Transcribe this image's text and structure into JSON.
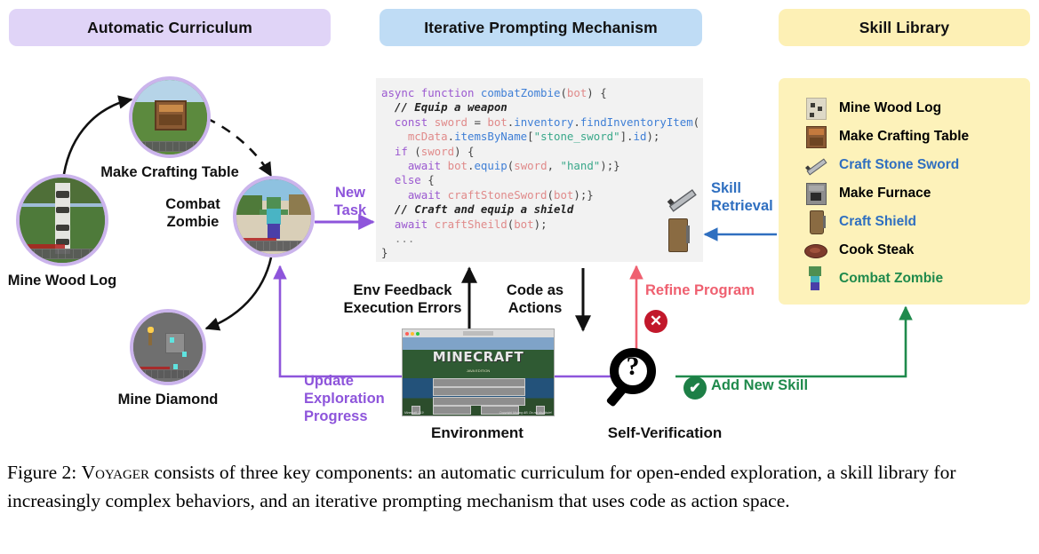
{
  "headers": {
    "curriculum": "Automatic Curriculum",
    "iterative": "Iterative Prompting Mechanism",
    "skill_library": "Skill Library"
  },
  "colors": {
    "curriculum_header_bg": "#e0d4f7",
    "iterative_header_bg": "#bfdcf5",
    "skill_header_bg": "#fdf0b5",
    "skill_panel_bg": "#fdf2ba",
    "code_panel_bg": "#f2f2f2",
    "purple_arrow": "#8e55db",
    "blue_arrow": "#2f6fc0",
    "red_arrow": "#ef6070",
    "green_arrow": "#1f8a4c",
    "black_arrow": "#111111",
    "circle_ring": "#cbb4ec"
  },
  "curriculum": {
    "nodes": [
      {
        "id": "mine-wood-log",
        "label": "Mine Wood Log"
      },
      {
        "id": "make-crafting-table",
        "label": "Make Crafting Table"
      },
      {
        "id": "combat-zombie",
        "label": "Combat\nZombie"
      },
      {
        "id": "mine-diamond",
        "label": "Mine Diamond"
      }
    ]
  },
  "code": {
    "lines": [
      {
        "tokens": [
          {
            "t": "async ",
            "c": "k"
          },
          {
            "t": "function ",
            "c": "k"
          },
          {
            "t": "combatZombie",
            "c": "fn"
          },
          {
            "t": "(",
            "c": "pl"
          },
          {
            "t": "bot",
            "c": "var"
          },
          {
            "t": ") {",
            "c": "pl"
          }
        ]
      },
      {
        "tokens": [
          {
            "t": "  // Equip a weapon",
            "c": "cm"
          }
        ]
      },
      {
        "tokens": [
          {
            "t": "  ",
            "c": "pl"
          },
          {
            "t": "const ",
            "c": "k"
          },
          {
            "t": "sword ",
            "c": "var"
          },
          {
            "t": "= ",
            "c": "pl"
          },
          {
            "t": "bot",
            "c": "var"
          },
          {
            "t": ".",
            "c": "pl"
          },
          {
            "t": "inventory",
            "c": "fn"
          },
          {
            "t": ".",
            "c": "pl"
          },
          {
            "t": "findInventoryItem",
            "c": "fn"
          },
          {
            "t": "(",
            "c": "pl"
          }
        ]
      },
      {
        "tokens": [
          {
            "t": "    ",
            "c": "pl"
          },
          {
            "t": "mcData",
            "c": "var"
          },
          {
            "t": ".",
            "c": "pl"
          },
          {
            "t": "itemsByName",
            "c": "fn"
          },
          {
            "t": "[",
            "c": "pl"
          },
          {
            "t": "\"stone_sword\"",
            "c": "str"
          },
          {
            "t": "].",
            "c": "pl"
          },
          {
            "t": "id",
            "c": "fn"
          },
          {
            "t": ");",
            "c": "pl"
          }
        ]
      },
      {
        "tokens": [
          {
            "t": "  ",
            "c": "pl"
          },
          {
            "t": "if",
            "c": "k"
          },
          {
            "t": " (",
            "c": "pl"
          },
          {
            "t": "sword",
            "c": "var"
          },
          {
            "t": ") {",
            "c": "pl"
          }
        ]
      },
      {
        "tokens": [
          {
            "t": "    ",
            "c": "pl"
          },
          {
            "t": "await ",
            "c": "k"
          },
          {
            "t": "bot",
            "c": "var"
          },
          {
            "t": ".",
            "c": "pl"
          },
          {
            "t": "equip",
            "c": "fn"
          },
          {
            "t": "(",
            "c": "pl"
          },
          {
            "t": "sword",
            "c": "var"
          },
          {
            "t": ", ",
            "c": "pl"
          },
          {
            "t": "\"hand\"",
            "c": "str"
          },
          {
            "t": ");}",
            "c": "pl"
          }
        ]
      },
      {
        "tokens": [
          {
            "t": "  ",
            "c": "pl"
          },
          {
            "t": "else",
            "c": "k"
          },
          {
            "t": " {",
            "c": "pl"
          }
        ]
      },
      {
        "tokens": [
          {
            "t": "    ",
            "c": "pl"
          },
          {
            "t": "await ",
            "c": "k"
          },
          {
            "t": "craftStoneSword",
            "c": "var"
          },
          {
            "t": "(",
            "c": "pl"
          },
          {
            "t": "bot",
            "c": "var"
          },
          {
            "t": ");}",
            "c": "pl"
          }
        ]
      },
      {
        "tokens": [
          {
            "t": "  // Craft and equip a shield",
            "c": "cm"
          }
        ]
      },
      {
        "tokens": [
          {
            "t": "  ",
            "c": "pl"
          },
          {
            "t": "await ",
            "c": "k"
          },
          {
            "t": "craftSheild",
            "c": "var"
          },
          {
            "t": "(",
            "c": "pl"
          },
          {
            "t": "bot",
            "c": "var"
          },
          {
            "t": ");",
            "c": "pl"
          }
        ]
      },
      {
        "tokens": [
          {
            "t": "  ...",
            "c": "dim"
          }
        ]
      },
      {
        "tokens": [
          {
            "t": "}",
            "c": "pl"
          }
        ]
      }
    ]
  },
  "skill_library": {
    "items": [
      {
        "icon": "wood-log-icon",
        "label": "Mine Wood  Log",
        "color": "#111111"
      },
      {
        "icon": "crafting-table-icon",
        "label": "Make Crafting Table",
        "color": "#111111"
      },
      {
        "icon": "stone-sword-icon",
        "label": "Craft Stone Sword",
        "color": "#2f6fc0"
      },
      {
        "icon": "furnace-icon",
        "label": "Make Furnace",
        "color": "#111111"
      },
      {
        "icon": "shield-icon",
        "label": "Craft Shield",
        "color": "#2f6fc0"
      },
      {
        "icon": "steak-icon",
        "label": "Cook Steak",
        "color": "#111111"
      },
      {
        "icon": "zombie-icon",
        "label": "Combat Zombie",
        "color": "#1f8a4c"
      }
    ]
  },
  "flow_labels": {
    "new_task": "New\nTask",
    "skill_retrieval": "Skill\nRetrieval",
    "env_feedback": "Env Feedback\nExecution Errors",
    "code_as_actions": "Code as\nActions",
    "refine_program": "Refine Program",
    "update_exploration": "Update\nExploration\nProgress",
    "add_new_skill": "Add New Skill",
    "environment": "Environment",
    "self_verification": "Self-Verification"
  },
  "badges": {
    "fail": "✕",
    "pass": "✔",
    "question": "?"
  },
  "environment_window": {
    "title": "Minecraft 1.19",
    "logo": "MINECRAFT",
    "subtitle": "JAVA EDITION",
    "buttons": [
      "Singleplayer",
      "Multiplayer",
      "Minecraft Realms"
    ],
    "footer_left": "Minecraft 1.19",
    "footer_right": "Copyright Mojang AB. Do not distribute!"
  },
  "caption": {
    "prefix": "Figure 2:  ",
    "smallcaps": "Voyager",
    "body": " consists of three key components: an automatic curriculum for open-ended exploration, a skill library for increasingly complex behaviors, and an iterative prompting mechanism that uses code as action space."
  }
}
